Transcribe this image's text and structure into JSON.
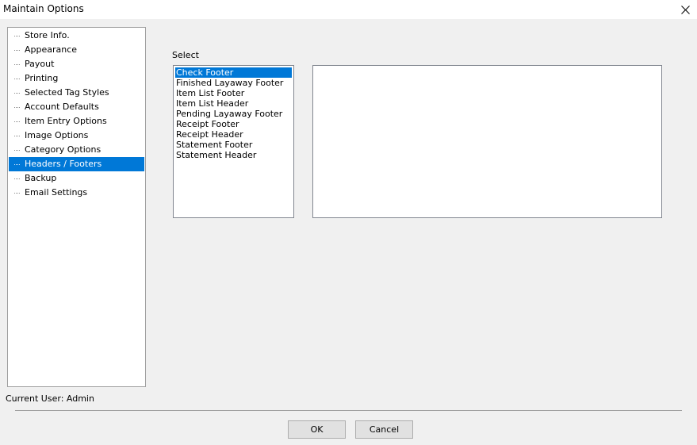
{
  "window": {
    "title": "Maintain Options"
  },
  "sidebar": {
    "items": [
      {
        "label": "Store Info."
      },
      {
        "label": "Appearance"
      },
      {
        "label": "Payout"
      },
      {
        "label": "Printing"
      },
      {
        "label": "Selected Tag Styles"
      },
      {
        "label": "Account Defaults"
      },
      {
        "label": "Item Entry Options"
      },
      {
        "label": "Image Options"
      },
      {
        "label": "Category Options"
      },
      {
        "label": "Headers / Footers"
      },
      {
        "label": "Backup"
      },
      {
        "label": "Email Settings"
      }
    ],
    "selected": "Headers / Footers"
  },
  "main": {
    "select_label": "Select",
    "list_items": [
      {
        "label": "Check Footer"
      },
      {
        "label": "Finished Layaway Footer"
      },
      {
        "label": "Item List Footer"
      },
      {
        "label": "Item List Header"
      },
      {
        "label": "Pending Layaway Footer"
      },
      {
        "label": "Receipt Footer"
      },
      {
        "label": "Receipt Header"
      },
      {
        "label": "Statement Footer"
      },
      {
        "label": "Statement Header"
      }
    ],
    "selected": "Check Footer",
    "text_value": ""
  },
  "status": {
    "current_user": "Current User: Admin"
  },
  "buttons": {
    "ok": "OK",
    "cancel": "Cancel"
  },
  "colors": {
    "selection": "#0078d7",
    "window_bg": "#f0f0f0"
  },
  "icons": {
    "close": "close-icon"
  }
}
